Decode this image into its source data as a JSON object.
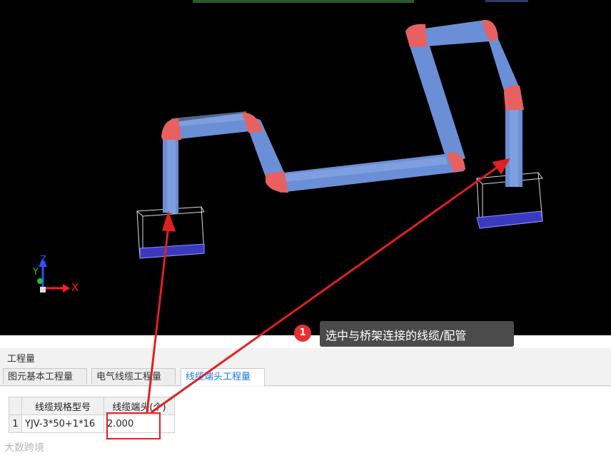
{
  "viewport": {
    "axes": {
      "x_label": "X",
      "y_label": "Y",
      "z_label": "Z"
    },
    "colors": {
      "tray": "#6b8fd6",
      "elbow": "#e86060",
      "background": "#000000"
    }
  },
  "callout": {
    "badge": "1",
    "text": "选中与桥架连接的线缆/配管"
  },
  "panel": {
    "title": "工程量",
    "tabs": [
      {
        "label": "图元基本工程量",
        "active": false
      },
      {
        "label": "电气线缆工程量",
        "active": false
      },
      {
        "label": "线缆端头工程量",
        "active": true
      }
    ],
    "table": {
      "headers": [
        "线缆规格型号",
        "线缆端头(个)"
      ],
      "rows": [
        {
          "index": "1",
          "spec": "YJV-3*50+1*16",
          "count": "2.000"
        }
      ]
    }
  },
  "watermark": "大数跨境",
  "accent_color": "#e02020"
}
